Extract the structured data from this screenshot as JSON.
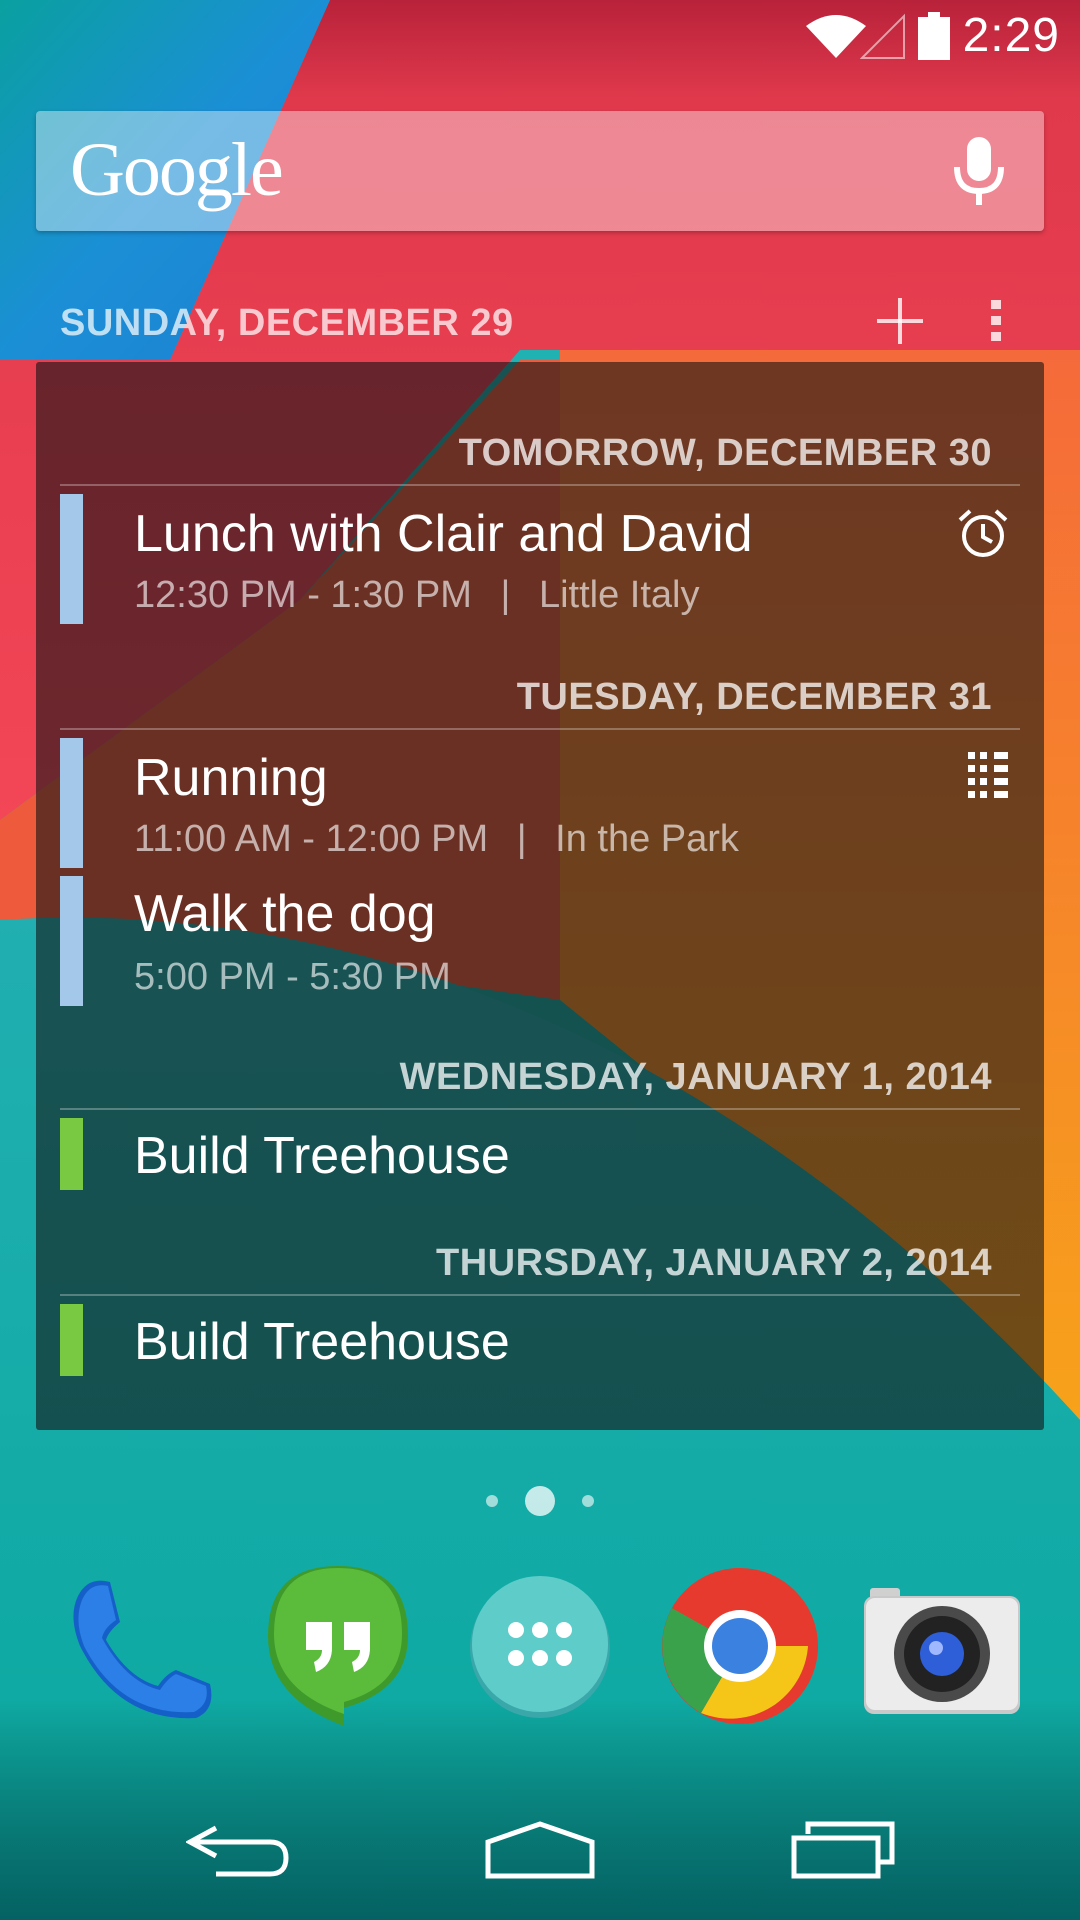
{
  "status_bar": {
    "time": "2:29"
  },
  "search": {
    "logo": "Google",
    "mic_icon": "microphone-icon"
  },
  "calendar": {
    "header_date": "SUNDAY, DECEMBER 29",
    "add_icon": "plus-icon",
    "more_icon": "more-vertical-icon",
    "days": [
      {
        "label": "TOMORROW, DECEMBER 30",
        "events": [
          {
            "title": "Lunch with Clair and David",
            "time": "12:30 PM - 1:30 PM",
            "location": "Little Italy",
            "color": "#a4c8ea",
            "icon": "alarm-icon"
          }
        ]
      },
      {
        "label": "TUESDAY, DECEMBER 31",
        "events": [
          {
            "title": "Running",
            "time": "11:00 AM - 12:00 PM",
            "location": "In the Park",
            "color": "#a4c8ea",
            "icon": "recurring-grid-icon"
          },
          {
            "title": "Walk the dog",
            "time": "5:00 PM - 5:30 PM",
            "location": "",
            "color": "#a4c8ea"
          }
        ]
      },
      {
        "label": "WEDNESDAY, JANUARY 1, 2014",
        "events": [
          {
            "title": "Build Treehouse",
            "color": "#7ac943"
          }
        ]
      },
      {
        "label": "THURSDAY, JANUARY 2, 2014",
        "events": [
          {
            "title": "Build Treehouse",
            "color": "#7ac943"
          }
        ]
      }
    ],
    "separator": "|"
  },
  "page_indicator": {
    "pages": 3,
    "current": 2
  },
  "dock": [
    {
      "name": "phone-icon"
    },
    {
      "name": "hangouts-icon"
    },
    {
      "name": "app-drawer-icon"
    },
    {
      "name": "chrome-icon"
    },
    {
      "name": "camera-icon"
    }
  ],
  "nav": {
    "back_icon": "back-icon",
    "home_icon": "home-icon",
    "recents_icon": "recents-icon"
  },
  "colors": {
    "wallpaper_teal": "#00a99d",
    "wallpaper_red": "#f0404f",
    "wallpaper_orange": "#f7861f",
    "wallpaper_blue": "#1a8ed8",
    "event_blue": "#a4c8ea",
    "event_green": "#7ac943"
  }
}
